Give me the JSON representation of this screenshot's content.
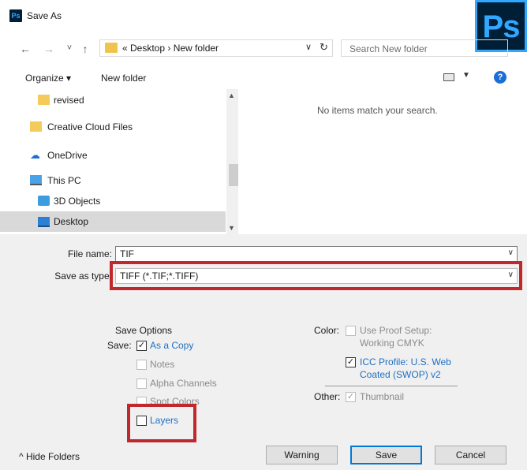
{
  "window": {
    "title": "Save As",
    "app_badge_small": "Ps",
    "app_badge_large": "Ps"
  },
  "nav": {
    "back": "←",
    "forward": "→",
    "recent": "˅",
    "up": "↑",
    "breadcrumb": "«  Desktop  ›  New folder",
    "refresh": "↻",
    "search_placeholder": "Search New folder"
  },
  "toolbar": {
    "organize": "Organize ▾",
    "new_folder": "New folder",
    "help": "?"
  },
  "nav_pane": {
    "items": [
      {
        "label": "revised",
        "icon": "folder-icon"
      },
      {
        "label": "Creative Cloud Files",
        "icon": "folder-icon"
      },
      {
        "label": "OneDrive",
        "icon": "cloud-icon"
      },
      {
        "label": "This PC",
        "icon": "computer-icon"
      },
      {
        "label": "3D Objects",
        "icon": "cube-icon"
      },
      {
        "label": "Desktop",
        "icon": "desktop-icon",
        "selected": true
      }
    ]
  },
  "content": {
    "empty_message": "No items match your search."
  },
  "form": {
    "file_name_label": "File name:",
    "file_name_value": "TIF",
    "save_as_type_label": "Save as type:",
    "save_as_type_value": "TIFF (*.TIF;*.TIFF)"
  },
  "save_options": {
    "heading": "Save Options",
    "save_label": "Save:",
    "as_a_copy": {
      "label": "As a Copy",
      "checked": true
    },
    "notes": {
      "label": "Notes",
      "checked": false
    },
    "alpha_channels": {
      "label": "Alpha Channels",
      "checked": false
    },
    "spot_colors": {
      "label": "Spot Colors",
      "checked": false
    },
    "layers": {
      "label": "Layers",
      "checked": false
    }
  },
  "color_options": {
    "color_label": "Color:",
    "use_proof_setup_line1": "Use Proof Setup:",
    "use_proof_setup_line2": "Working CMYK",
    "icc_profile_line1": "ICC Profile:  U.S. Web",
    "icc_profile_line2": "Coated (SWOP) v2",
    "other_label": "Other:",
    "thumbnail": "Thumbnail"
  },
  "footer": {
    "hide_folders": "^  Hide Folders",
    "warning": "Warning",
    "save": "Save",
    "cancel": "Cancel"
  },
  "colors": {
    "highlight_box": "#c0282e",
    "accent_blue": "#1f6fc2",
    "ps_dark": "#001e36",
    "ps_blue": "#31a8ff"
  }
}
